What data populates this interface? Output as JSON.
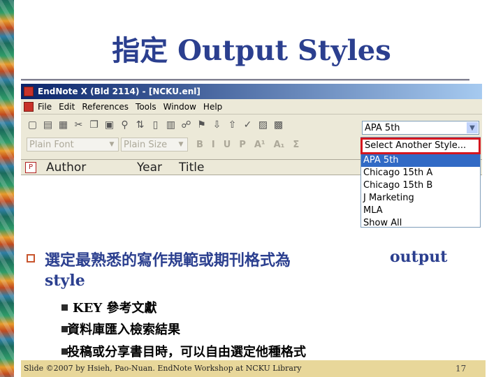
{
  "slide": {
    "title": "指定 Output Styles",
    "page_number": "17",
    "footer": "Slide ©2007 by Hsieh, Pao-Nuan. EndNote Workshop at NCKU Library"
  },
  "app": {
    "window_title": "EndNote X (Bld 2114) - [NCKU.enl]",
    "menu": [
      "File",
      "Edit",
      "References",
      "Tools",
      "Window",
      "Help"
    ],
    "style_dropdown_value": "APA 5th",
    "font_box": "Plain Font",
    "size_box": "Plain Size",
    "format_buttons": [
      "B",
      "I",
      "U",
      "P",
      "A¹",
      "A₁",
      "Σ"
    ],
    "columns": [
      "Author",
      "Year",
      "Title"
    ],
    "style_options": [
      "Select Another Style...",
      "APA 5th",
      "Chicago 15th A",
      "Chicago 15th B",
      "J Marketing",
      "MLA",
      "Show All"
    ],
    "selected_option": "APA 5th"
  },
  "bullets": {
    "main_line1": "選定最熟悉的寫作規範或期刊格式為",
    "main_line1_tail": "output",
    "main_line2": "style",
    "sub": [
      "KEY 參考文獻",
      "資料庫匯入檢索結果",
      "投稿或分享書目時，可以自由選定他種格式"
    ]
  },
  "colors": {
    "title": "#2b3f8f",
    "highlight_box": "#d4161f",
    "footer_band": "#e8d79a"
  }
}
